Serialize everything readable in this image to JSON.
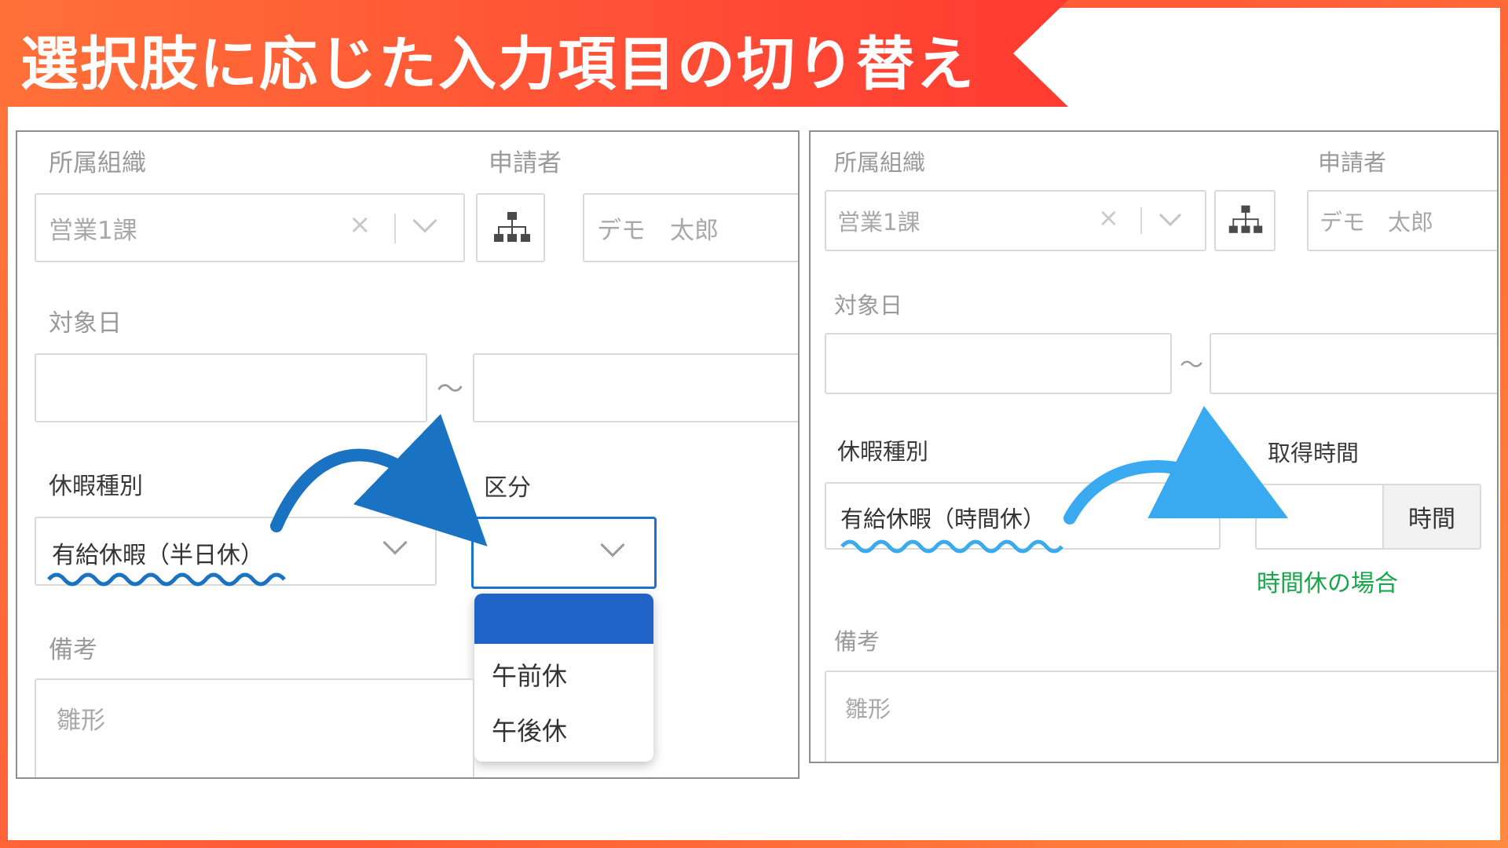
{
  "banner": {
    "title": "選択肢に応じた入力項目の切り替え"
  },
  "left": {
    "org_label": "所属組織",
    "org_value": "営業1課",
    "applicant_label": "申請者",
    "applicant_value": "デモ　太郎",
    "date_label": "対象日",
    "tilde": "～",
    "leave_type_label": "休暇種別",
    "leave_type_value": "有給休暇（半日休）",
    "division_label": "区分",
    "division_options": [
      "",
      "午前休",
      "午後休"
    ],
    "remarks_label": "備考",
    "remarks_placeholder": "雛形"
  },
  "right": {
    "org_label": "所属組織",
    "org_value": "営業1課",
    "applicant_label": "申請者",
    "applicant_value": "デモ　太郎",
    "date_label": "対象日",
    "tilde": "～",
    "leave_type_label": "休暇種別",
    "leave_type_value": "有給休暇（時間休）",
    "hours_label": "取得時間",
    "hours_unit": "時間",
    "hours_note": "時間休の場合",
    "remarks_label": "備考",
    "remarks_placeholder": "雛形"
  },
  "icons": {
    "clear": "×",
    "org_tree": "org-tree-icon",
    "chevron": "chevron-down-icon",
    "arrow": "curved-arrow-icon",
    "wavy": "wavy-underline"
  },
  "colors": {
    "accent_dark_blue": "#1a73d4",
    "accent_light_blue": "#3aaaf0",
    "menu_highlight": "#1f63c6",
    "note_green": "#18a64a",
    "banner": "#ff4a35"
  }
}
